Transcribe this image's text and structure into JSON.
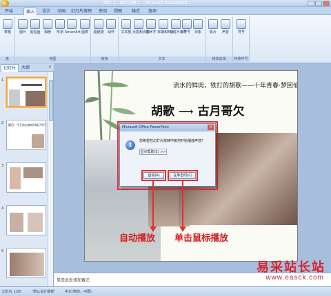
{
  "window": {
    "title": "图片 1 - 演示文稿 1 - Microsoft PowerPoint"
  },
  "ribbon": {
    "tabs": [
      {
        "label": "开始"
      },
      {
        "label": "插入"
      },
      {
        "label": "设计"
      },
      {
        "label": "动画"
      },
      {
        "label": "幻灯片放映"
      },
      {
        "label": "审阅"
      },
      {
        "label": "视图"
      },
      {
        "label": "格式"
      },
      {
        "label": "选项"
      }
    ],
    "active_tab": "插入",
    "groups": [
      {
        "label": "表",
        "buttons": [
          {
            "label": "表格"
          }
        ]
      },
      {
        "label": "插图",
        "buttons": [
          {
            "label": "图片"
          },
          {
            "label": "剪贴画"
          },
          {
            "label": "相册"
          },
          {
            "label": "形状"
          },
          {
            "label": "SmartArt"
          },
          {
            "label": "图表"
          }
        ]
      },
      {
        "label": "链接",
        "buttons": [
          {
            "label": "超链接"
          },
          {
            "label": "动作"
          }
        ]
      },
      {
        "label": "文本",
        "buttons": [
          {
            "label": "文本框"
          },
          {
            "label": "页眉和页脚"
          },
          {
            "label": "艺术字"
          },
          {
            "label": "日期和时间"
          },
          {
            "label": "幻灯片编号"
          },
          {
            "label": "符号"
          },
          {
            "label": "对象"
          }
        ]
      },
      {
        "label": "媒体剪辑",
        "buttons": [
          {
            "label": "影片"
          },
          {
            "label": "声音"
          }
        ]
      },
      {
        "label": "特殊符号",
        "buttons": [
          {
            "label": "符号"
          }
        ]
      }
    ]
  },
  "left_panel": {
    "tabs": [
      {
        "label": "幻灯片"
      },
      {
        "label": "大纲"
      }
    ],
    "close_icon": "×",
    "slides": [
      {
        "number": "1",
        "caption": "",
        "selected": true
      },
      {
        "number": "2",
        "caption": "题目：今天你过来的时候了吗?",
        "selected": false
      },
      {
        "number": "3",
        "caption": "",
        "selected": false
      },
      {
        "number": "4",
        "caption": "",
        "selected": false
      },
      {
        "number": "5",
        "caption": "",
        "selected": false
      }
    ]
  },
  "slide": {
    "header_text": "流水的鲜肉，铁打的胡歌——十年青春·梦回仙侠",
    "title_left": "胡歌",
    "title_arrow": "⟶",
    "title_right": "古月哥欠",
    "annotation_auto": "自动播放",
    "annotation_click": "单击鼠标播放"
  },
  "dialog": {
    "title": "Microsoft Office PowerPoint",
    "message": "您希望在幻灯片放映中如何开始播放声音？",
    "help_button": "显示帮助(E) >>",
    "auto_button": "自动(A)",
    "click_button": "在单击时(C)",
    "icon": "info-icon"
  },
  "notes": {
    "placeholder": "单击此处添加备注"
  },
  "status_bar": {
    "slide_counter": "幻灯片 1/25",
    "theme": "\"默认设计模板\"",
    "language": "中文(简体，中国)"
  },
  "watermark": {
    "main": "易采站长站",
    "url": "www.easck.com"
  },
  "colors": {
    "annotation_red": "#e23030",
    "ribbon_blue": "#15428b",
    "selected_thumb": "#f3a63b"
  }
}
